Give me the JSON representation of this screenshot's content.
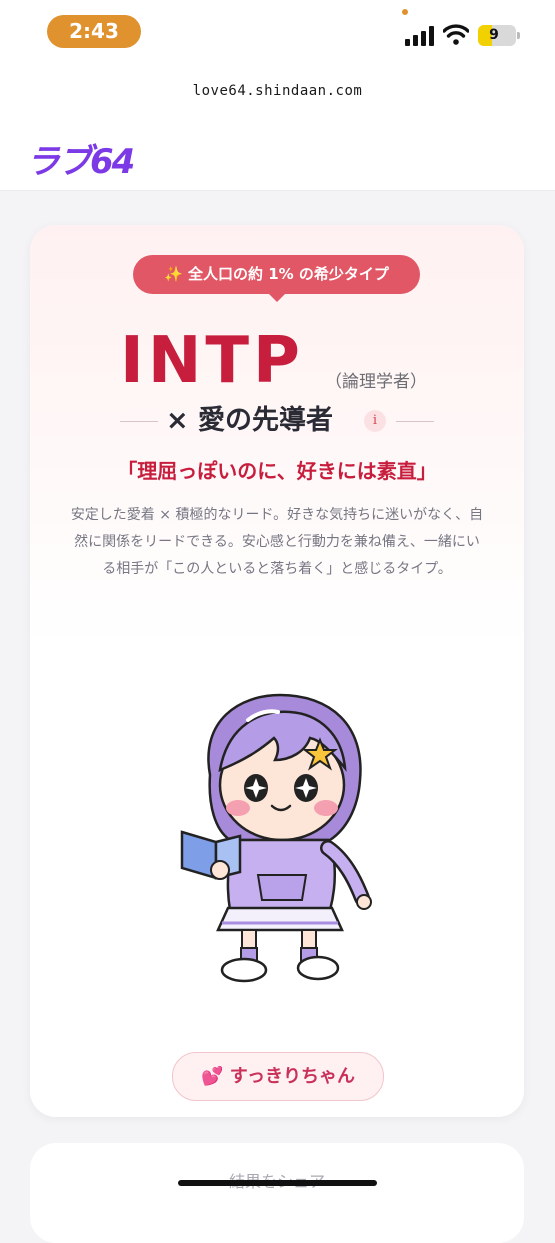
{
  "status": {
    "time": "2:43",
    "battery": "9"
  },
  "browser": {
    "url": "love64.shindaan.com"
  },
  "header": {
    "logo": "ラブ64"
  },
  "result": {
    "rarity_badge": "✨ 全人口の約 1% の希少タイプ",
    "type_code": "INTP",
    "type_name": "（論理学者）",
    "love_style": "× 愛の先導者",
    "info_symbol": "i",
    "catchphrase": "「理屈っぽいのに、好きには素直」",
    "description": "安定した愛着 × 積極的なリード。好きな気持ちに迷いがなく、自然に関係をリードできる。安心感と行動力を兼ね備え、一緒にいる相手が「この人といると落ち着く」と感じるタイプ。",
    "character_button": "💕 すっきりちゃん"
  },
  "share": {
    "label": "結果をシェア"
  },
  "colors": {
    "accent": "#c81e3e",
    "badge": "#e25766",
    "logo": "#7c3ae6",
    "status_pill": "#e0922e"
  }
}
